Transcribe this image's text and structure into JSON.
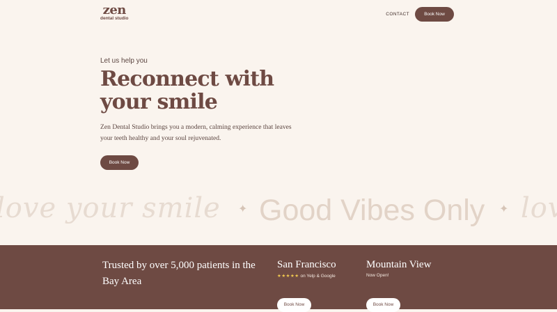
{
  "header": {
    "logo": {
      "mark": "zen",
      "subtitle": "dental studio"
    },
    "nav": {
      "contact_label": "CONTACT",
      "book_label": "Book Now"
    }
  },
  "hero": {
    "eyebrow": "Let us help you",
    "headline": "Reconnect with your smile",
    "lede": "Zen Dental Studio brings you a modern, calming experience that leaves your teeth healthy and your soul rejuvenated.",
    "cta_label": "Book Now"
  },
  "marquee": {
    "script_text": "love your smile",
    "sparkle": "✦",
    "slogan": "Good Vibes Only",
    "script_text_repeat": "lov"
  },
  "band": {
    "trust_text": "Trusted by over 5,000 patients in the Bay Area",
    "locations": [
      {
        "name": "San Francisco",
        "stars": "★★★★★",
        "note": "on Yelp & Google",
        "cta": "Book Now"
      },
      {
        "name": "Mountain View",
        "note": "Now Open!",
        "cta": "Book Now"
      }
    ]
  },
  "colors": {
    "brand": "#6e4a43",
    "background": "#faf4ee",
    "star": "#f0c850"
  }
}
